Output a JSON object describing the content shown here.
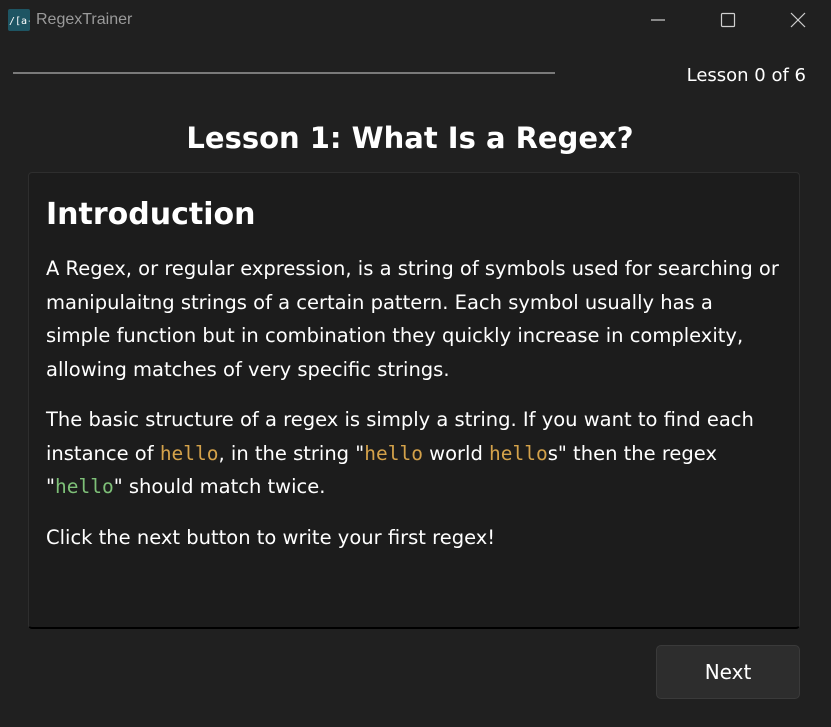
{
  "window": {
    "title": "RegexTrainer",
    "app_icon": "regex-app-icon",
    "controls": [
      "minimize-icon",
      "maximize-icon",
      "close-icon"
    ]
  },
  "progress": {
    "fraction": 0.0,
    "lesson_count": "Lesson 0 of 6"
  },
  "lesson": {
    "title": "Lesson 1: What Is a Regex?",
    "heading": "Introduction",
    "paragraph1": "A Regex, or regular expression, is a string of symbols used for searching or manipulaitng strings of a certain pattern. Each symbol usually has a simple function but in combination they quickly increase in complexity, allowing matches of very specific strings.",
    "paragraph2": {
      "t1": "The basic structure of a regex is simply a string. If you want to find each instance of ",
      "c1": "hello",
      "t2": ", in the string \"",
      "c2": "hello",
      "t3": " world ",
      "c3": "hello",
      "t4": "s\" then the regex \"",
      "c4": "hello",
      "t5": "\" should match twice."
    },
    "paragraph3": "Click the next button to write your first regex!"
  },
  "actions": {
    "next_label": "Next"
  },
  "colors": {
    "background": "#202020",
    "card": "#1c1c1c",
    "code_orange": "#d4a24a",
    "code_green": "#7ec078",
    "button": "#2d2d2d"
  }
}
